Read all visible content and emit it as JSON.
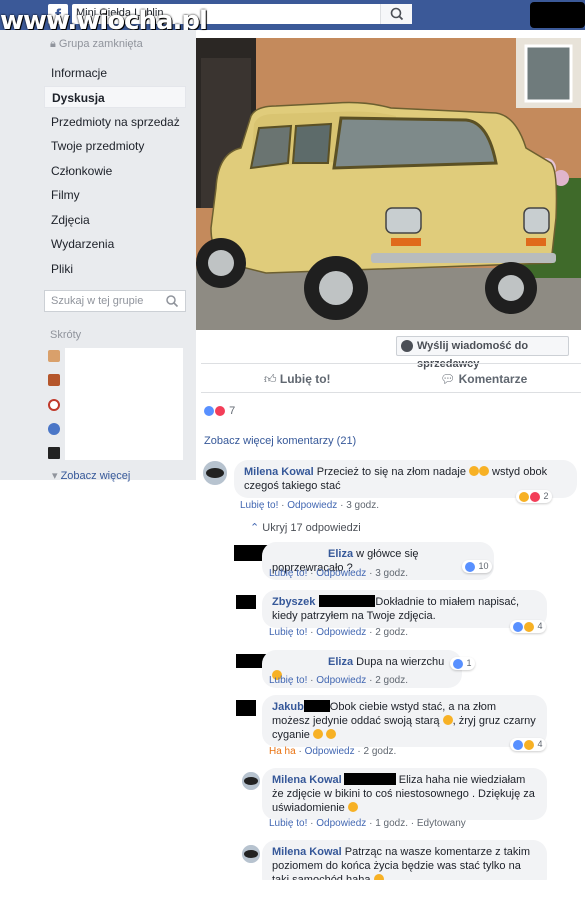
{
  "watermark": "www.wiocha.pl",
  "header": {
    "search_value": "Mini Giełda Lublin"
  },
  "sidebar": {
    "group_status": "Grupa zamknięta",
    "items": [
      {
        "label": "Informacje"
      },
      {
        "label": "Dyskusja",
        "active": true
      },
      {
        "label": "Przedmioty na sprzedaż"
      },
      {
        "label": "Twoje przedmioty"
      },
      {
        "label": "Członkowie"
      },
      {
        "label": "Filmy"
      },
      {
        "label": "Zdjęcia"
      },
      {
        "label": "Wydarzenia"
      },
      {
        "label": "Pliki"
      }
    ],
    "search_placeholder": "Szukaj w tej grupie",
    "shortcuts_title": "Skróty",
    "see_more": "Zobacz więcej"
  },
  "post": {
    "message_seller": "Wyślij wiadomość do sprzedawcy",
    "like_label": "Lubię to!",
    "comment_label": "Komentarze",
    "reactions_count": "7",
    "more_comments": "Zobacz więcej komentarzy (21)",
    "hide_replies": "Ukryj 17 odpowiedzi"
  },
  "comments": [
    {
      "author": "Milena Kowal",
      "text": "Przecież to się na złom nadaje",
      "text_after": " wstyd obok czegoś takiego stać",
      "like": "Lubię to!",
      "reply": "Odpowiedz",
      "time": "3 godz.",
      "reactions": "2"
    },
    {
      "author": "Eliza",
      "text": "w główce się poprzewracało ?",
      "like": "Lubię to!",
      "reply": "Odpowiedz",
      "time": "3 godz.",
      "reactions": "10"
    },
    {
      "author": "Zbyszek",
      "text": "Dokładnie to miałem napisać, kiedy patrzyłem na Twoje zdjęcia.",
      "like": "Lubię to!",
      "reply": "Odpowiedz",
      "time": "2 godz.",
      "reactions": "4"
    },
    {
      "author": "Eliza",
      "text": "Dupa na wierzchu",
      "like": "Lubię to!",
      "reply": "Odpowiedz",
      "time": "2 godz.",
      "reactions": "1"
    },
    {
      "author": "Jakub",
      "text": "Obok ciebie wstyd stać, a na złom możesz jedynie oddać swoją starą",
      "text_after": ", żryj gruz czarny cyganie",
      "like": "Ha ha",
      "reply": "Odpowiedz",
      "time": "2 godz.",
      "reactions": "4"
    },
    {
      "author": "Milena Kowal",
      "text": "Eliza haha nie wiedziałam że zdjęcie w bikini to coś niestosownego . Dziękuję za uświadomienie",
      "like": "Lubię to!",
      "reply": "Odpowiedz",
      "time": "1 godz.",
      "edited": "Edytowany"
    },
    {
      "author": "Milena Kowal",
      "text": "Patrząc na wasze komentarze z takim poziomem do końca życia będzie was stać tylko na taki samochód haha"
    }
  ]
}
